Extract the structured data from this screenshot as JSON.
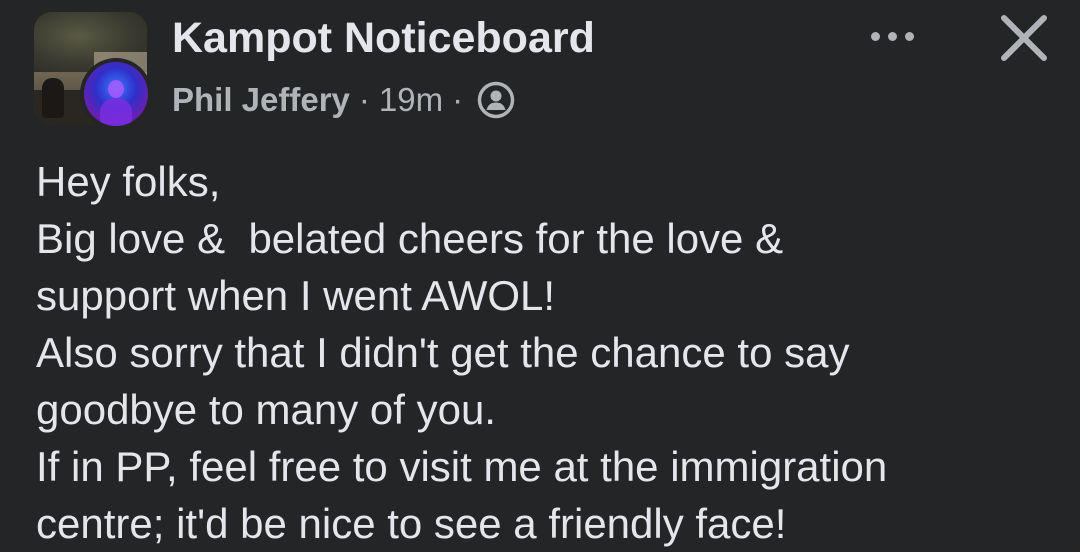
{
  "header": {
    "group_name": "Kampot Noticeboard",
    "author": "Phil Jeffery",
    "separator": "·",
    "time": "19m",
    "audience_icon": "public-members-icon",
    "more_icon": "more-options-icon",
    "close_icon": "close-icon"
  },
  "post": {
    "lines": [
      "Hey folks,",
      "Big love &  belated cheers for the love &",
      "support when I went AWOL!",
      "Also sorry that I didn't get the chance to say",
      "goodbye to many of you.",
      "If in PP, feel free to visit me at the immigration",
      "centre; it'd be nice to see a friendly face!"
    ]
  },
  "colors": {
    "background": "#242526",
    "primary_text": "#e4e6eb",
    "secondary_text": "#b0b3b8"
  }
}
